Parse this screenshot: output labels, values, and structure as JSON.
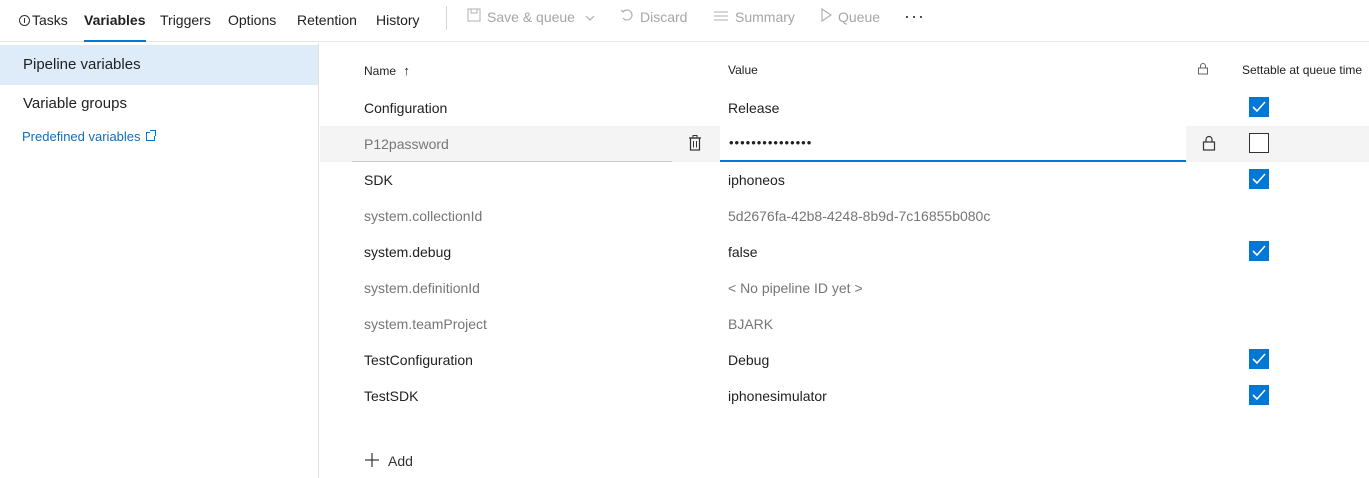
{
  "nav": {
    "tabs": [
      {
        "label": "Tasks"
      },
      {
        "label": "Variables"
      },
      {
        "label": "Triggers"
      },
      {
        "label": "Options"
      },
      {
        "label": "Retention"
      },
      {
        "label": "History"
      }
    ],
    "active_tab": "Variables",
    "toolbar": {
      "save_queue": "Save & queue",
      "discard": "Discard",
      "summary": "Summary",
      "queue": "Queue",
      "more": "···"
    }
  },
  "sidebar": {
    "items": [
      {
        "label": "Pipeline variables",
        "selected": true
      },
      {
        "label": "Variable groups",
        "selected": false
      }
    ],
    "link": "Predefined variables"
  },
  "grid": {
    "headers": {
      "name": "Name",
      "sort": "↑",
      "value": "Value",
      "settable": "Settable at queue time"
    },
    "rows": [
      {
        "name": "Configuration",
        "value": "Release",
        "settable": true
      },
      {
        "name": "P12password",
        "value": "•••••••••••••••",
        "settable": false
      },
      {
        "name": "SDK",
        "value": "iphoneos",
        "settable": true
      },
      {
        "name": "system.collectionId",
        "value": "5d2676fa-42b8-4248-8b9d-7c16855b080c",
        "settable": null
      },
      {
        "name": "system.debug",
        "value": "false",
        "settable": true
      },
      {
        "name": "system.definitionId",
        "value": "< No pipeline ID yet >",
        "settable": null
      },
      {
        "name": "system.teamProject",
        "value": "BJARK",
        "settable": null
      },
      {
        "name": "TestConfiguration",
        "value": "Debug",
        "settable": true
      },
      {
        "name": "TestSDK",
        "value": "iphonesimulator",
        "settable": true
      }
    ],
    "add_label": "Add"
  },
  "colors": {
    "accent": "#0078d4",
    "selected_bg": "#deecf9",
    "muted_text": "#767676"
  }
}
